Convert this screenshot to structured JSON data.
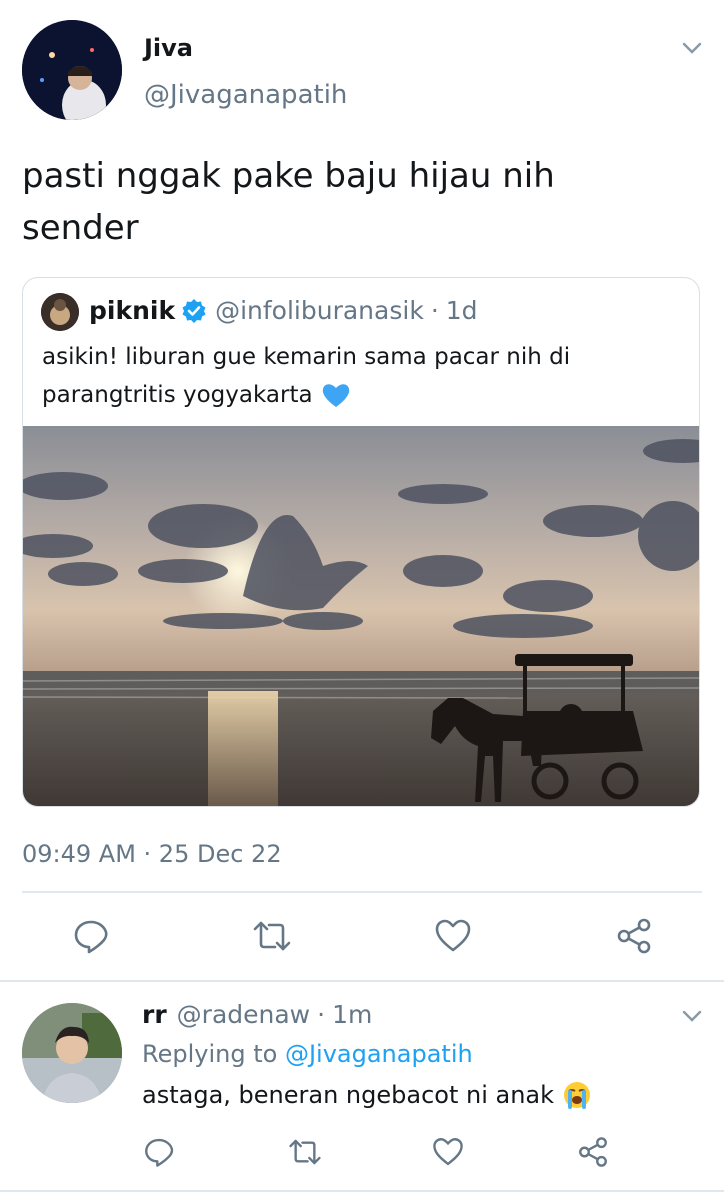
{
  "tweet": {
    "author": {
      "name": "Jiva",
      "handle": "@Jivaganapatih"
    },
    "text_line1": "pasti nggak pake baju hijau nih",
    "text_line2": "sender",
    "quoted": {
      "name": "piknik",
      "handle": "@infoliburanasik",
      "sep": "·",
      "time": "1d",
      "text_line1": "asikin! liburan gue kemarin sama pacar nih di",
      "text_line2": "parangtritis yogyakarta",
      "emoji": "💙"
    },
    "timestamp": "09:49 AM · 25 Dec 22",
    "actions": [
      "reply-icon",
      "retweet-icon",
      "like-icon",
      "share-icon"
    ]
  },
  "reply": {
    "name": "rr",
    "handle": "@radenaw",
    "sep": "·",
    "time": "1m",
    "replying_prefix": "Replying to",
    "replying_handle": "@Jivaganapatih",
    "text": "astaga, beneran ngebacot ni anak",
    "emoji": "😭",
    "actions": [
      "reply-icon",
      "retweet-icon",
      "like-icon",
      "share-icon"
    ]
  },
  "colors": {
    "accent": "#1da1f2",
    "grey": "#657786",
    "divider": "#e1e8ed"
  }
}
